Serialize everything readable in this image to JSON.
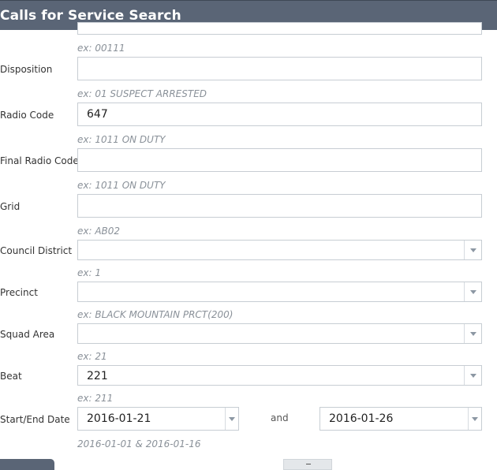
{
  "header": {
    "title": "Calls for Service Search"
  },
  "fields": {
    "top_hint": "ex: 00111",
    "disposition": {
      "label": "Disposition",
      "value": "",
      "hint": "ex: 01 SUSPECT ARRESTED"
    },
    "radio_code": {
      "label": "Radio Code",
      "value": "647",
      "hint": "ex: 1011 ON DUTY"
    },
    "final_radio_code": {
      "label": "Final Radio Code",
      "value": "",
      "hint": "ex: 1011 ON DUTY"
    },
    "grid": {
      "label": "Grid",
      "value": "",
      "hint": "ex: AB02"
    },
    "council_district": {
      "label": "Council District",
      "value": "",
      "hint": "ex: 1"
    },
    "precinct": {
      "label": "Precinct",
      "value": "",
      "hint": "ex: BLACK MOUNTAIN PRCT(200)"
    },
    "squad_area": {
      "label": "Squad Area",
      "value": "",
      "hint": "ex: 21"
    },
    "beat": {
      "label": "Beat",
      "value": "221",
      "hint": "ex: 211"
    },
    "dates": {
      "label": "Start/End Date",
      "start": "2016-01-21",
      "and_label": "and",
      "end": "2016-01-26",
      "hint": "2016-01-01 & 2016-01-16"
    }
  },
  "colors": {
    "header_bg": "#5a6576",
    "hint_text": "#8a9199",
    "border": "#c7cdd3"
  }
}
